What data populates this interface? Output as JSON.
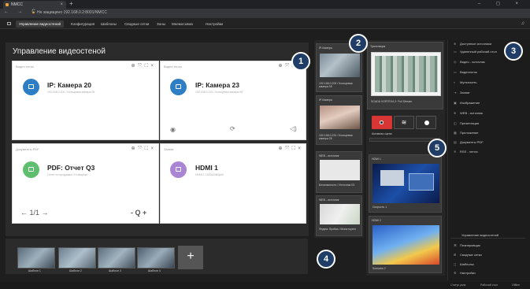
{
  "browser": {
    "tab_title": "NMCC",
    "tab_close": "×",
    "new_tab": "+",
    "nav_buttons": "← → C",
    "url_warning": "Не защищено",
    "url": "192.168.0.2:8001/NMCC",
    "window_controls": "– ◻ ×"
  },
  "menu": {
    "items": [
      "Управление видеостеной",
      "Конфигурация",
      "Шаблоны",
      "Сводные сетки",
      "Зоны",
      "Мнемосхема",
      "Настройки"
    ],
    "bell_icon": "bell-icon"
  },
  "main": {
    "title": "Управление видеостеной",
    "panels": [
      {
        "header": "Видео поток",
        "title": "IP: Камера 20",
        "subtitle": "192.168.0.200 / Кольцевая камера 05",
        "icon_color": "#2d7ec4"
      },
      {
        "header": "Видео поток",
        "title": "IP: Камера 23",
        "subtitle": "192.168.0.231 / Кольцевая камера 05",
        "icon_color": "#2d7ec4"
      },
      {
        "header": "Документы PDF",
        "title": "PDF: Отчет Q3",
        "subtitle": "Отчет по продажам 3 й квартал",
        "icon_color": "#5fbf6f"
      },
      {
        "header": "Захват",
        "title": "HDMI 1",
        "subtitle": "HDMI 1 1920x1080p60",
        "icon_color": "#a985d4"
      }
    ],
    "panel_controls": "⊕ ⤧ ⛶ ×",
    "pdf_pages": "← 1/1 →",
    "pdf_zoom": "- Q +"
  },
  "sources": {
    "cards": [
      {
        "label": "IP-Камера",
        "sub": "192.168.0.200 / Кольцевая камера 05"
      },
      {
        "label": "IP-Камера",
        "sub": "192.168.0.231 / Кольцевая камера 05"
      },
      {
        "label": "WEB - источник",
        "sub": "Безопасность / Источник 03"
      },
      {
        "label": "WEB - источник",
        "sub": "Яндекс Пробки / Мониторинг"
      }
    ]
  },
  "broadcast": {
    "label": "Трансляция",
    "caption": "SCADA VORTEXA 2: Full Stream",
    "active_scene": "Активная сцена"
  },
  "outputs": [
    {
      "label": "HDMI 1",
      "sub": "Скорость 1"
    },
    {
      "label": "HDMI 2",
      "sub": "Scenario 2"
    }
  ],
  "right_sidebar": {
    "items": [
      {
        "icon": "⊕",
        "label": "Доступные источники"
      },
      {
        "icon": "▭",
        "label": "Удаленный рабочий стол"
      },
      {
        "icon": "◎",
        "label": "Видео - источник"
      },
      {
        "icon": "▭",
        "label": "Видеопоток"
      },
      {
        "icon": "▿",
        "label": "Мультисеть"
      },
      {
        "icon": "⇥",
        "label": "Захват"
      },
      {
        "icon": "▣",
        "label": "Изображение"
      },
      {
        "icon": "⊕",
        "label": "WEB - источник"
      },
      {
        "icon": "◫",
        "label": "Презентация"
      },
      {
        "icon": "▦",
        "label": "Приложение"
      },
      {
        "icon": "▤",
        "label": "Документы PDF"
      },
      {
        "icon": "≋",
        "label": "RSS - лента"
      }
    ],
    "section_title": "Управление видеостеной",
    "bottom_items": [
      {
        "icon": "⌘",
        "label": "Планировщик"
      },
      {
        "icon": "⊞",
        "label": "Сводные сетки"
      },
      {
        "icon": "◻",
        "label": "Шаблоны"
      },
      {
        "icon": "⚙",
        "label": "Настройки"
      }
    ]
  },
  "templates": {
    "items": [
      "Шаблон 1",
      "Шаблон 2",
      "Шаблон 3",
      "Шаблон 4"
    ],
    "add_label": "+"
  },
  "status": {
    "left": "Статус узла",
    "mid": "Рабочий стол",
    "right": "Offline"
  },
  "callouts": [
    "1",
    "2",
    "3",
    "4",
    "5"
  ]
}
